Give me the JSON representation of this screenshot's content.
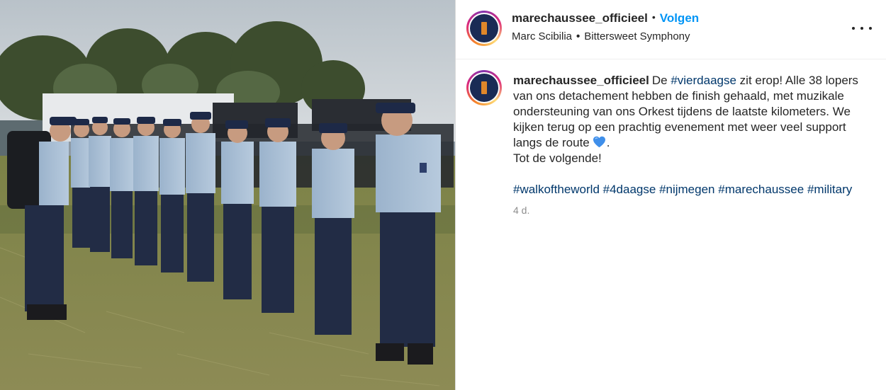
{
  "header": {
    "username": "marechaussee_officieel",
    "separator": "•",
    "follow_label": "Volgen",
    "music": {
      "artist": "Marc Scibilia",
      "separator": "•",
      "track": "Bittersweet Symphony"
    },
    "more_icon": "more-horizontal-icon"
  },
  "caption": {
    "username": "marechaussee_officieel",
    "text_1": "De",
    "tag_1": "#vierdaagse",
    "text_2": "zit erop! Alle 38 lopers van ons detachement hebben de finish gehaald, met muzikale ondersteuning van ons Orkest tijdens de laatste kilometers. We kijken terug op een prachtig evenement met weer veel support langs de route",
    "emoji": "blue-heart-icon",
    "text_3": ".",
    "line_2": "Tot de volgende!",
    "hashtags": [
      "#walkoftheworld",
      "#4daagse",
      "#nijmegen",
      "#marechaussee",
      "#military"
    ],
    "timestamp": "4 d."
  },
  "colors": {
    "link_blue": "#0095f6",
    "hashtag_blue": "#00376b",
    "muted": "#8e8e8e",
    "avatar_bg": "#1a2b55",
    "avatar_rank": "#e0872a"
  }
}
